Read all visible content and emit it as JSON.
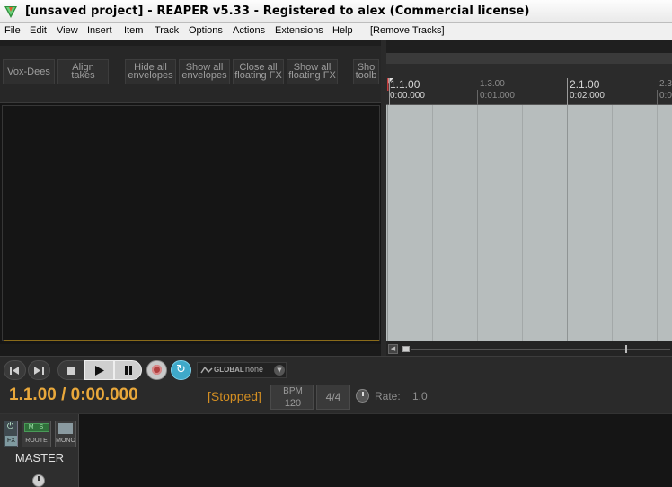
{
  "window": {
    "title": "[unsaved project] - REAPER v5.33 - Registered to alex (Commercial license)"
  },
  "menubar": {
    "items": [
      "File",
      "Edit",
      "View",
      "Insert",
      "Item",
      "Track",
      "Options",
      "Actions",
      "Extensions",
      "Help",
      "[Remove Tracks]"
    ]
  },
  "toolbar": {
    "vox_dees": "Vox-Dees",
    "align_takes_1": "Align",
    "align_takes_2": "takes",
    "hide_env_1": "Hide all",
    "hide_env_2": "envelopes",
    "show_env_1": "Show all",
    "show_env_2": "envelopes",
    "close_fx_1": "Close all",
    "close_fx_2": "floating FX",
    "show_fx_1": "Show all",
    "show_fx_2": "floating FX",
    "show_toolbar_1": "Sho",
    "show_toolbar_2": "toolb"
  },
  "ruler": {
    "marks": [
      {
        "bar": "1.1.00",
        "time": "0:00.000",
        "major": true
      },
      {
        "bar": "1.3.00",
        "time": "0:01.000",
        "major": false
      },
      {
        "bar": "2.1.00",
        "time": "0:02.000",
        "major": true
      },
      {
        "bar": "2.3",
        "time": "0:0",
        "major": false
      }
    ]
  },
  "transport": {
    "position": "1.1.00 / 0:00.000",
    "state": "[Stopped]",
    "bpm_label": "BPM",
    "bpm_value": "120",
    "time_signature": "4/4",
    "rate_label": "Rate:",
    "rate_value": "1.0",
    "global_label": "GLOBAL",
    "global_value": "none"
  },
  "mixer": {
    "master_name": "MASTER",
    "fx_label": "FX",
    "route_label": "ROUTE",
    "mono_label": "MONO",
    "ms_label": "M S"
  },
  "colors": {
    "time_display": "#e9a83b",
    "state": "#d38e22",
    "arrange_bg": "#b7bdbd",
    "loop": "#3fa9c9"
  }
}
